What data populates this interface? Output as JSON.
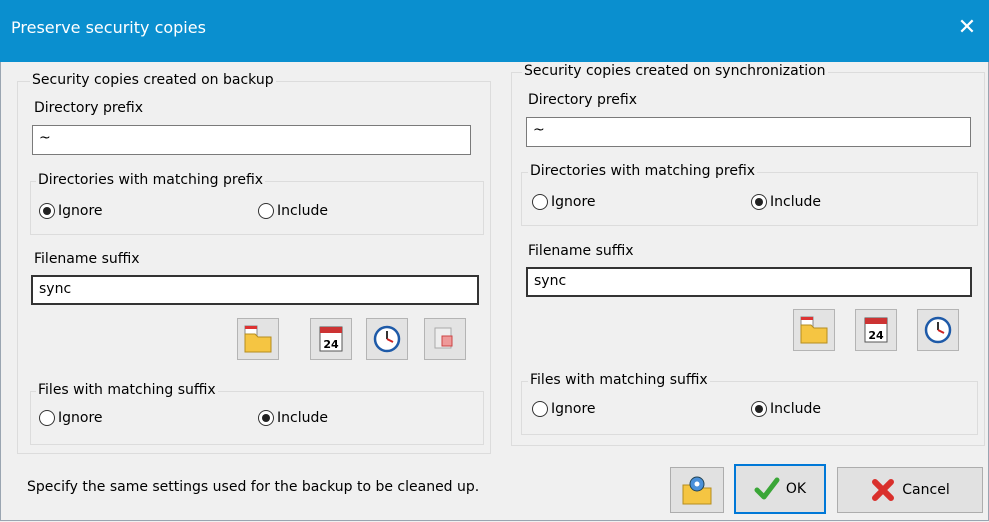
{
  "window": {
    "title": "Preserve security copies",
    "close_symbol": "✕",
    "title_bar_color": "#0a8fcf"
  },
  "backup": {
    "group_title": "Security copies created on backup",
    "dir_prefix_label": "Directory prefix",
    "dir_prefix_value": "~",
    "dirs_group_title": "Directories with matching prefix",
    "dirs_ignore": "Ignore",
    "dirs_include": "Include",
    "dirs_selected": "Ignore",
    "suffix_label": "Filename suffix",
    "suffix_value": "sync",
    "files_group_title": "Files with matching suffix",
    "files_ignore": "Ignore",
    "files_include": "Include",
    "files_selected": "Include",
    "icons": [
      "folder-date-icon",
      "calendar-icon",
      "clock-icon",
      "remove-icon"
    ]
  },
  "sync": {
    "group_title": "Security copies created on synchronization",
    "dir_prefix_label": "Directory prefix",
    "dir_prefix_value": "~",
    "dirs_group_title": "Directories with matching prefix",
    "dirs_ignore": "Ignore",
    "dirs_include": "Include",
    "dirs_selected": "Include",
    "suffix_label": "Filename suffix",
    "suffix_value": "sync",
    "files_group_title": "Files with matching suffix",
    "files_ignore": "Ignore",
    "files_include": "Include",
    "files_selected": "Include",
    "icons": [
      "folder-date-icon",
      "calendar-icon",
      "clock-icon"
    ]
  },
  "footer": {
    "hint": "Specify the same settings used for the backup to be cleaned up.",
    "ok_label": "OK",
    "cancel_label": "Cancel",
    "calendar_day": "24"
  }
}
